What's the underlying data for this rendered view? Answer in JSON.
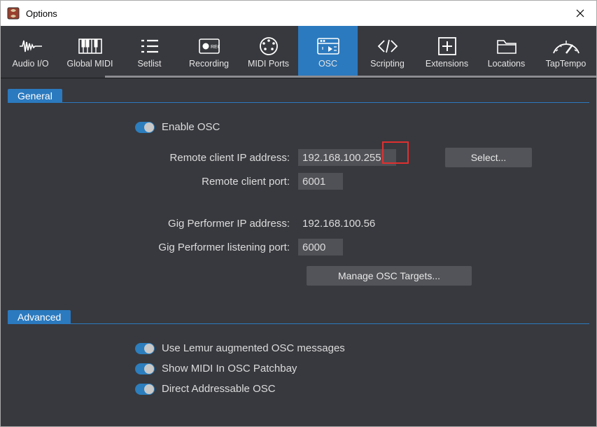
{
  "window": {
    "title": "Options"
  },
  "tabs": [
    {
      "label": "Audio I/O"
    },
    {
      "label": "Global MIDI"
    },
    {
      "label": "Setlist"
    },
    {
      "label": "Recording"
    },
    {
      "label": "MIDI Ports"
    },
    {
      "label": "OSC"
    },
    {
      "label": "Scripting"
    },
    {
      "label": "Extensions"
    },
    {
      "label": "Locations"
    },
    {
      "label": "TapTempo"
    }
  ],
  "active_tab": 5,
  "sections": {
    "general": "General",
    "advanced": "Advanced"
  },
  "osc": {
    "enable_label": "Enable OSC",
    "remote_ip_label": "Remote client IP address:",
    "remote_ip_value": "192.168.100.255",
    "remote_port_label": "Remote client port:",
    "remote_port_value": "6001",
    "gp_ip_label": "Gig Performer IP address:",
    "gp_ip_value": "192.168.100.56",
    "gp_port_label": "Gig Performer listening port:",
    "gp_port_value": "6000",
    "select_btn": "Select...",
    "manage_btn": "Manage OSC Targets..."
  },
  "advanced": {
    "lemur_label": "Use Lemur augmented OSC messages",
    "midi_label": "Show MIDI In OSC Patchbay",
    "direct_label": "Direct Addressable OSC"
  }
}
